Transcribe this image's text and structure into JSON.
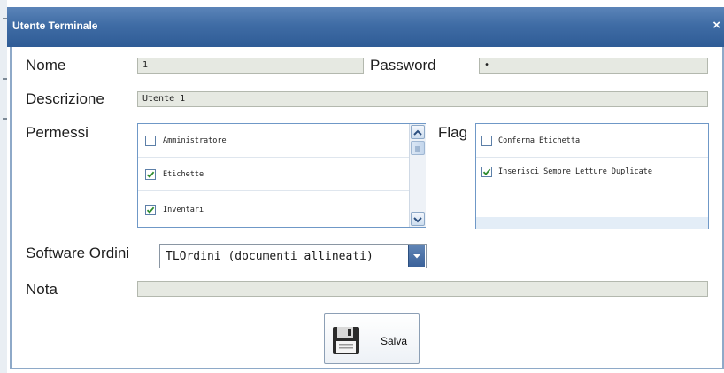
{
  "dialog": {
    "title": "Utente Terminale",
    "close_label": "×"
  },
  "form": {
    "nome_label": "Nome",
    "nome_value": "1",
    "password_label": "Password",
    "password_value": "•",
    "descrizione_label": "Descrizione",
    "descrizione_value": "Utente 1",
    "permessi_label": "Permessi",
    "permessi": [
      {
        "label": "Amministratore",
        "checked": false
      },
      {
        "label": "Etichette",
        "checked": true
      },
      {
        "label": "Inventari",
        "checked": true
      }
    ],
    "flag_label": "Flag",
    "flags": [
      {
        "label": "Conferma Etichetta",
        "checked": false
      },
      {
        "label": "Inserisci Sempre Letture Duplicate",
        "checked": true
      }
    ],
    "software_ordini_label": "Software Ordini",
    "software_ordini_value": "TLOrdini (documenti allineati)",
    "nota_label": "Nota",
    "nota_value": ""
  },
  "save_button": {
    "label": "Salva",
    "icon": "floppy-disk-icon"
  },
  "colors": {
    "titlebar": "#3f6ca5",
    "field_bg": "#e6e9e2",
    "list_border": "#6f98c7",
    "check": "#2e8b2e"
  }
}
